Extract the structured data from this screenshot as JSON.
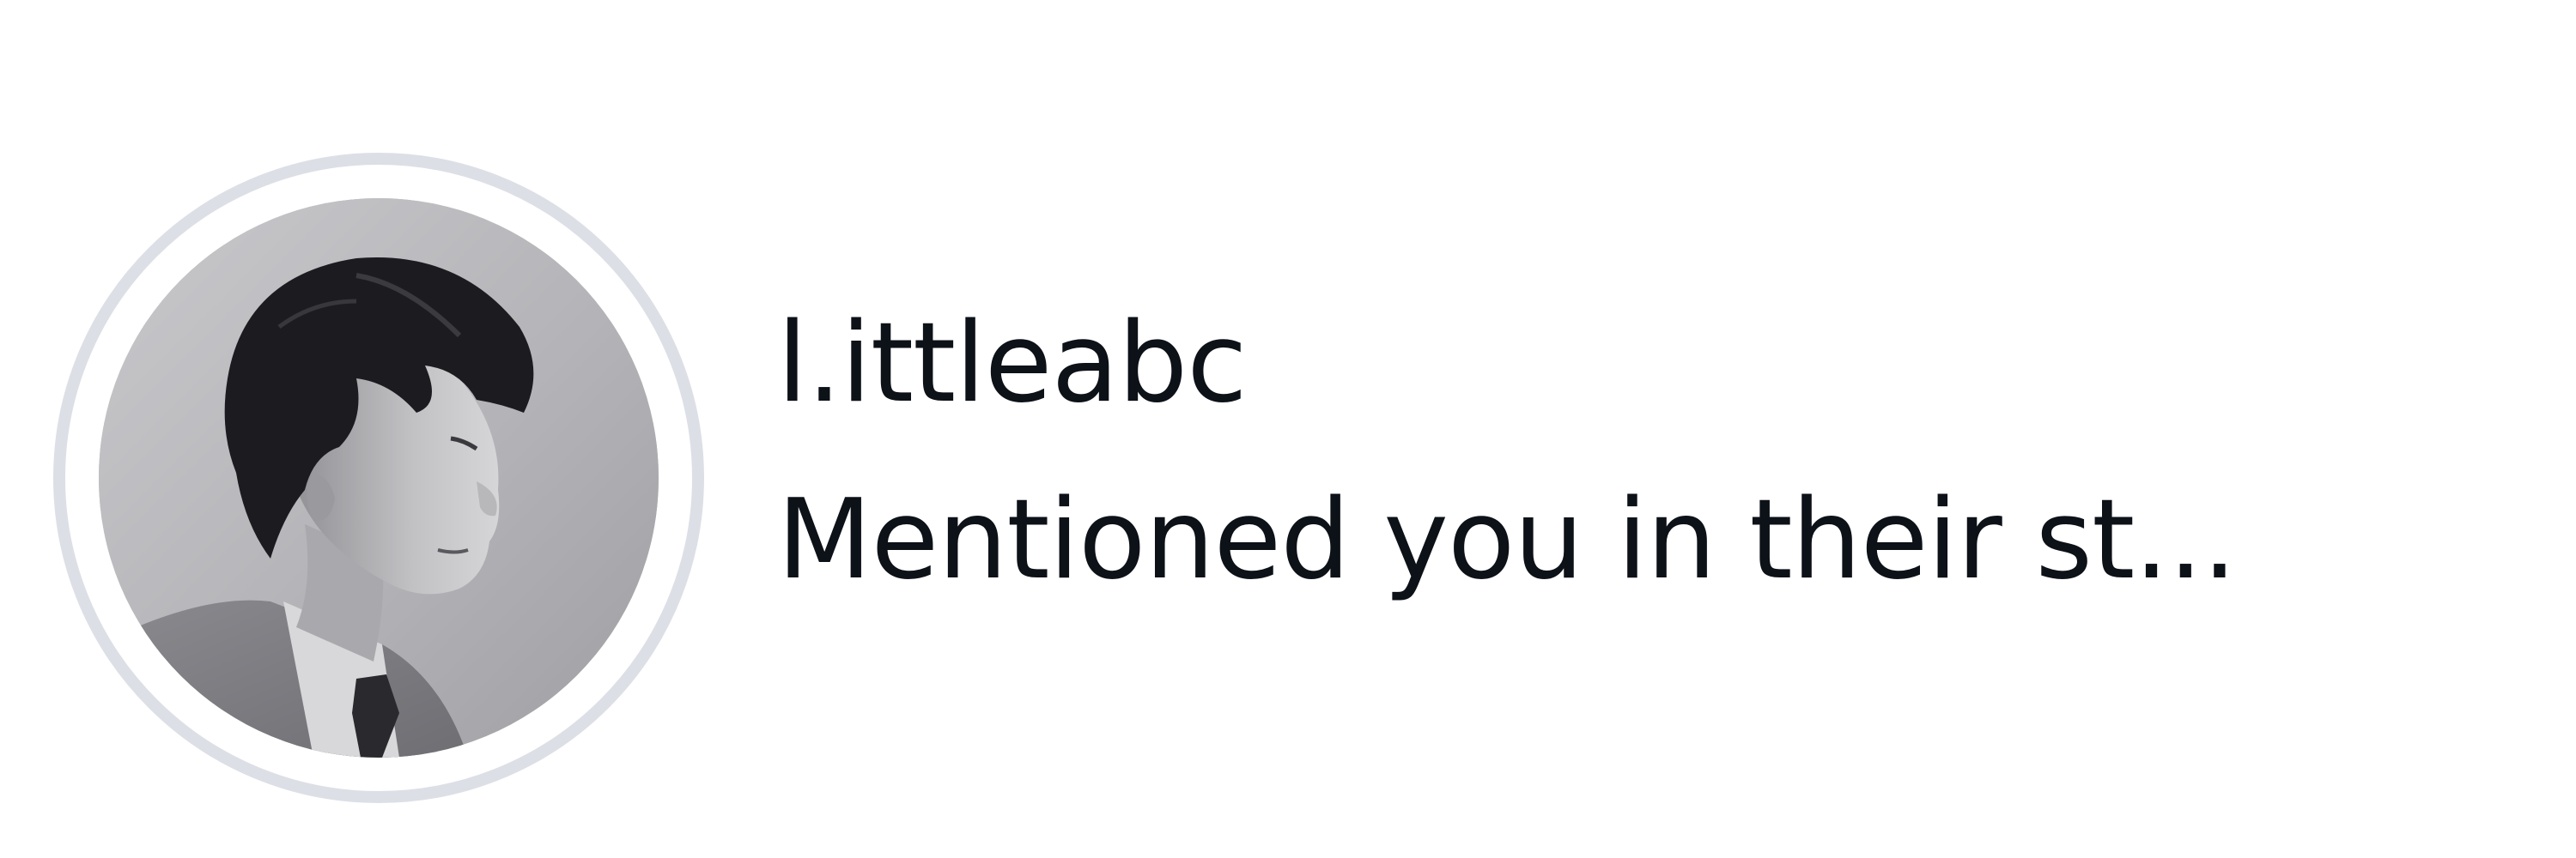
{
  "notification": {
    "username": "l.ittleabc",
    "message": "Mentioned you in their st...",
    "avatar": {
      "ring_state": "story-viewed",
      "ring_color": "#dcdfe6"
    }
  },
  "colors": {
    "background": "#ffffff",
    "text": "#0d1118"
  }
}
